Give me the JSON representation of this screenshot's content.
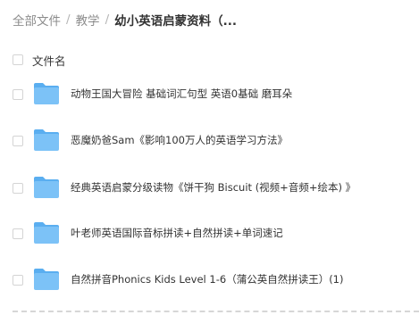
{
  "breadcrumb": {
    "items": [
      "全部文件",
      "教学",
      "幼小英语启蒙资料（..."
    ],
    "separator": "/"
  },
  "table": {
    "header_label": "文件名"
  },
  "files": [
    {
      "name": "动物王国大冒险 基础词汇句型 英语0基础 磨耳朵",
      "type": "folder"
    },
    {
      "name": "恶魔奶爸Sam《影响100万人的英语学习方法》",
      "type": "folder"
    },
    {
      "name": "经典英语启蒙分级读物《饼干狗 Biscuit (视频+音频+绘本) 》",
      "type": "folder"
    },
    {
      "name": "叶老师英语国际音标拼读+自然拼读+单词速记",
      "type": "folder"
    },
    {
      "name": "自然拼音Phonics Kids Level 1-6（蒲公英自然拼读王）(1)",
      "type": "folder"
    }
  ],
  "colors": {
    "folder_body": "#7cc2f7",
    "folder_tab": "#5aaef0",
    "breadcrumb_muted": "#8c8c8c",
    "text": "#333333"
  },
  "icons": {
    "folder": "folder-icon",
    "checkbox": "checkbox"
  }
}
